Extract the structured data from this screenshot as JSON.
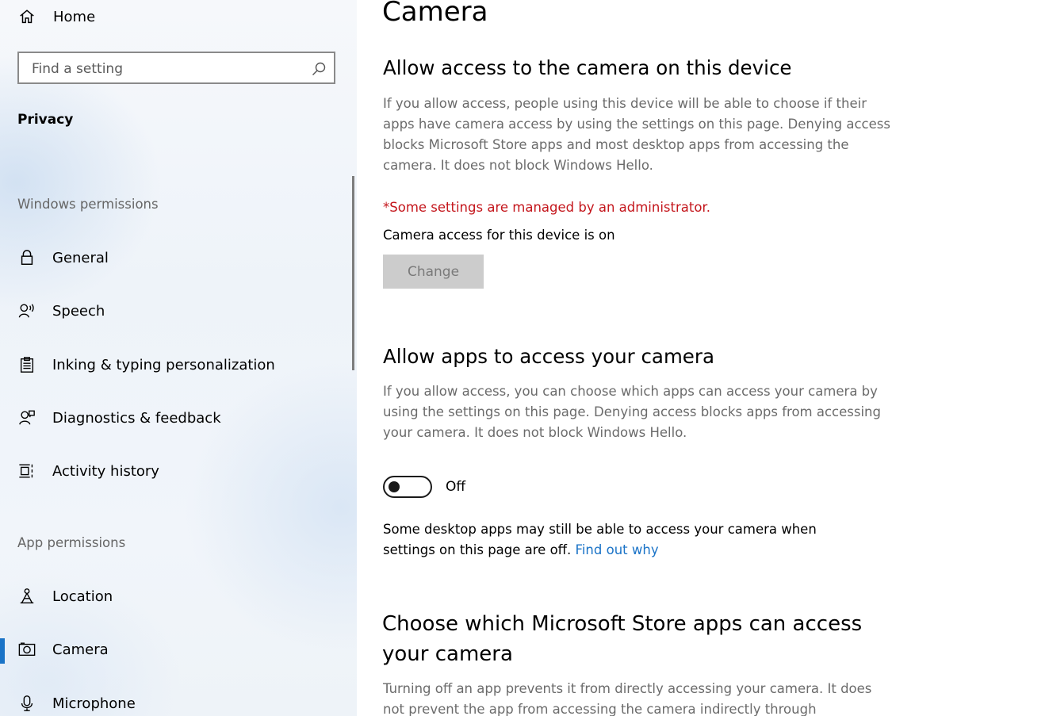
{
  "sidebar": {
    "home_label": "Home",
    "search_placeholder": "Find a setting",
    "section_title": "Privacy",
    "group_windows": "Windows permissions",
    "group_app": "App permissions",
    "windows_items": [
      {
        "label": "General",
        "icon": "lock-icon"
      },
      {
        "label": "Speech",
        "icon": "speech-icon"
      },
      {
        "label": "Inking & typing personalization",
        "icon": "clipboard-icon"
      },
      {
        "label": "Diagnostics & feedback",
        "icon": "diagnostics-icon"
      },
      {
        "label": "Activity history",
        "icon": "activity-history-icon"
      }
    ],
    "app_items": [
      {
        "label": "Location",
        "icon": "location-icon"
      },
      {
        "label": "Camera",
        "icon": "camera-icon",
        "selected": true
      },
      {
        "label": "Microphone",
        "icon": "microphone-icon"
      }
    ],
    "accent_color": "#1a73c7"
  },
  "main": {
    "title": "Camera",
    "device_section": {
      "heading": "Allow access to the camera on this device",
      "description": "If you allow access, people using this device will be able to choose if their apps have camera access by using the settings on this page. Denying access blocks Microsoft Store apps and most desktop apps from accessing the camera. It does not block Windows Hello.",
      "admin_note": "*Some settings are managed by an administrator.",
      "status": "Camera access for this device is on",
      "change_label": "Change"
    },
    "apps_section": {
      "heading": "Allow apps to access your camera",
      "description": "If you allow access, you can choose which apps can access your camera by using the settings on this page. Denying access blocks apps from accessing your camera. It does not block Windows Hello.",
      "toggle_state": "Off",
      "toggle_on": false,
      "note": "Some desktop apps may still be able to access your camera when settings on this page are off.",
      "link": "Find out why"
    },
    "store_section": {
      "heading": "Choose which Microsoft Store apps can access your camera",
      "description": "Turning off an app prevents it from directly accessing your camera. It does not prevent the app from accessing the camera indirectly through"
    }
  }
}
